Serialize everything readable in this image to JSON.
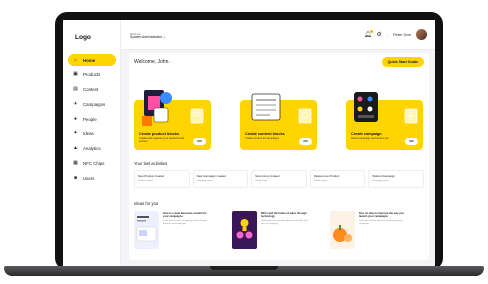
{
  "app": {
    "logo": "Logo"
  },
  "sidebar": {
    "items": [
      {
        "label": "Home",
        "icon": "home-icon",
        "glyph": "⌂",
        "active": true
      },
      {
        "label": "Products",
        "icon": "box-icon",
        "glyph": "▣",
        "active": false
      },
      {
        "label": "Content",
        "icon": "document-icon",
        "glyph": "▤",
        "active": false
      },
      {
        "label": "Campaigns",
        "icon": "megaphone-icon",
        "glyph": "✈",
        "active": false
      },
      {
        "label": "People",
        "icon": "person-icon",
        "glyph": "●",
        "active": false
      },
      {
        "label": "Ideas",
        "icon": "lightbulb-icon",
        "glyph": "✦",
        "active": false
      },
      {
        "label": "Analytics",
        "icon": "chart-icon",
        "glyph": "▲",
        "active": false
      },
      {
        "label": "NFC Chips",
        "icon": "chip-icon",
        "glyph": "▦",
        "active": false
      },
      {
        "label": "Users",
        "icon": "users-icon",
        "glyph": "■",
        "active": false
      }
    ]
  },
  "topbar": {
    "workspace_label": "Work as",
    "workspace_role": "System Administrator",
    "user_name": "Peter Doe"
  },
  "main": {
    "welcome": "Welcome, John.",
    "quick_start": "Quick Start Guide",
    "cards": [
      {
        "title": "Create product blocks",
        "subtitle": "Create and organize your products and content",
        "button": "GO"
      },
      {
        "title": "Create content blocks",
        "subtitle": "Create content for campaigns",
        "button": "GO"
      },
      {
        "title": "Create campaign",
        "subtitle": "Start a campaign and send it out",
        "button": "GO"
      }
    ],
    "activities_title": "Your last activities",
    "activities": [
      {
        "title": "New Product created",
        "subtitle": "Product name 1"
      },
      {
        "title": "New Campaign created",
        "subtitle": "Campaign name"
      },
      {
        "title": "New Group created",
        "subtitle": "Group name"
      },
      {
        "title": "Deleted one Product",
        "subtitle": "Product name"
      },
      {
        "title": "Started Campaign",
        "subtitle": "Campaign name"
      }
    ],
    "ideas_title": "Ideas for you",
    "ideas": [
      {
        "title": "How to create awesome content for your campaigns",
        "desc": "Learn how to create compelling content for your audience and campaigns"
      },
      {
        "title": "NFCs and the future of sales through technology",
        "desc": "Read about the latest developments with NFC and how it is changing"
      },
      {
        "title": "Tips on How to improve the way you launch your campaigns",
        "desc": "Learn tips and best practices for launching your campaigns"
      }
    ]
  },
  "colors": {
    "accent": "#ffd400",
    "background": "#f4f4f6"
  }
}
